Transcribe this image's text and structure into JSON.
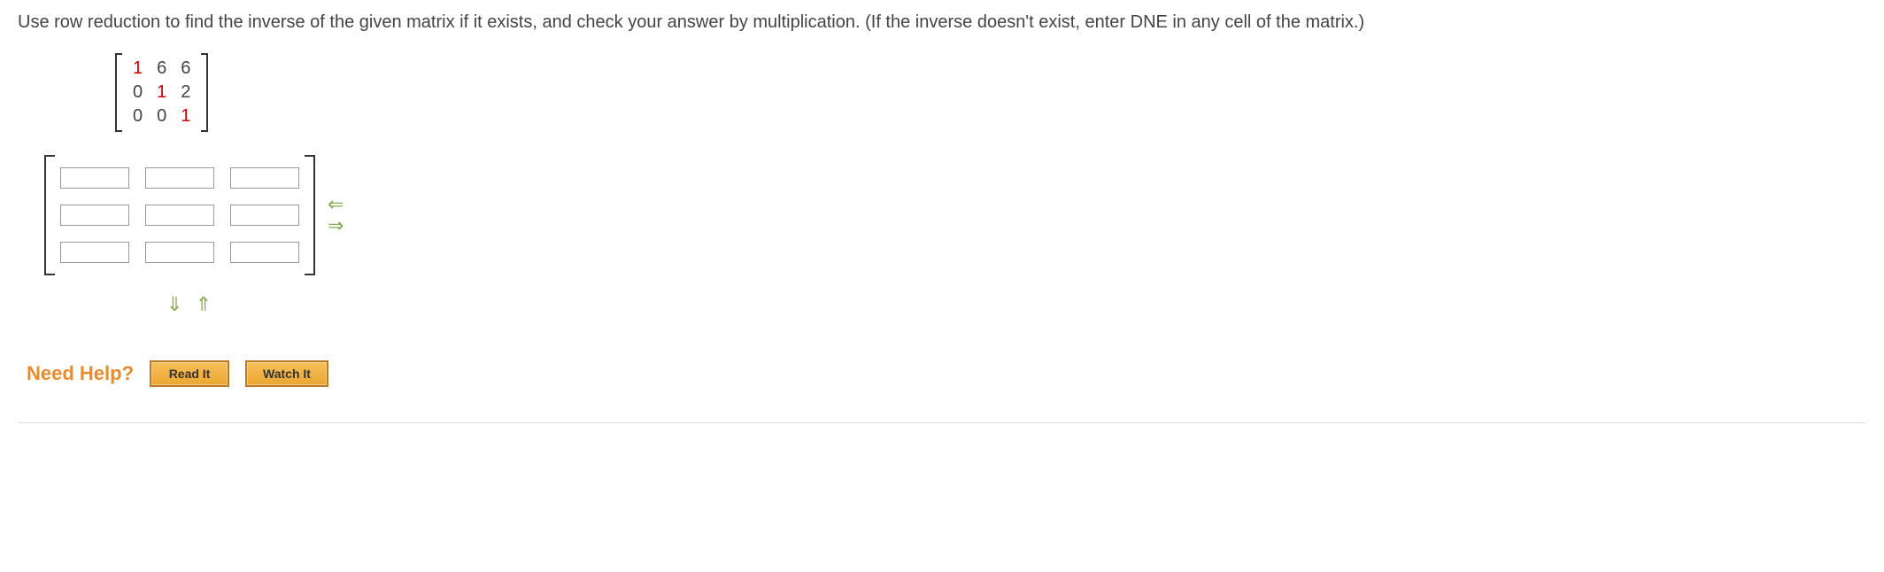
{
  "question": {
    "text": "Use row reduction to find the inverse of the given matrix if it exists, and check your answer by multiplication. (If the inverse doesn't exist, enter DNE in any cell of the matrix.)"
  },
  "matrix": {
    "r0": {
      "c0": "1",
      "c1": "6",
      "c2": "6"
    },
    "r1": {
      "c0": "0",
      "c1": "1",
      "c2": "2"
    },
    "r2": {
      "c0": "0",
      "c1": "0",
      "c2": "1"
    }
  },
  "answer": {
    "cells": {
      "r0c0": "",
      "r0c1": "",
      "r0c2": "",
      "r1c0": "",
      "r1c1": "",
      "r1c2": "",
      "r2c0": "",
      "r2c1": "",
      "r2c2": ""
    }
  },
  "help": {
    "label": "Need Help?",
    "read": "Read It",
    "watch": "Watch It"
  },
  "arrows": {
    "left": "⇐",
    "right": "⇒",
    "down": "⇓",
    "up": "⇑"
  }
}
